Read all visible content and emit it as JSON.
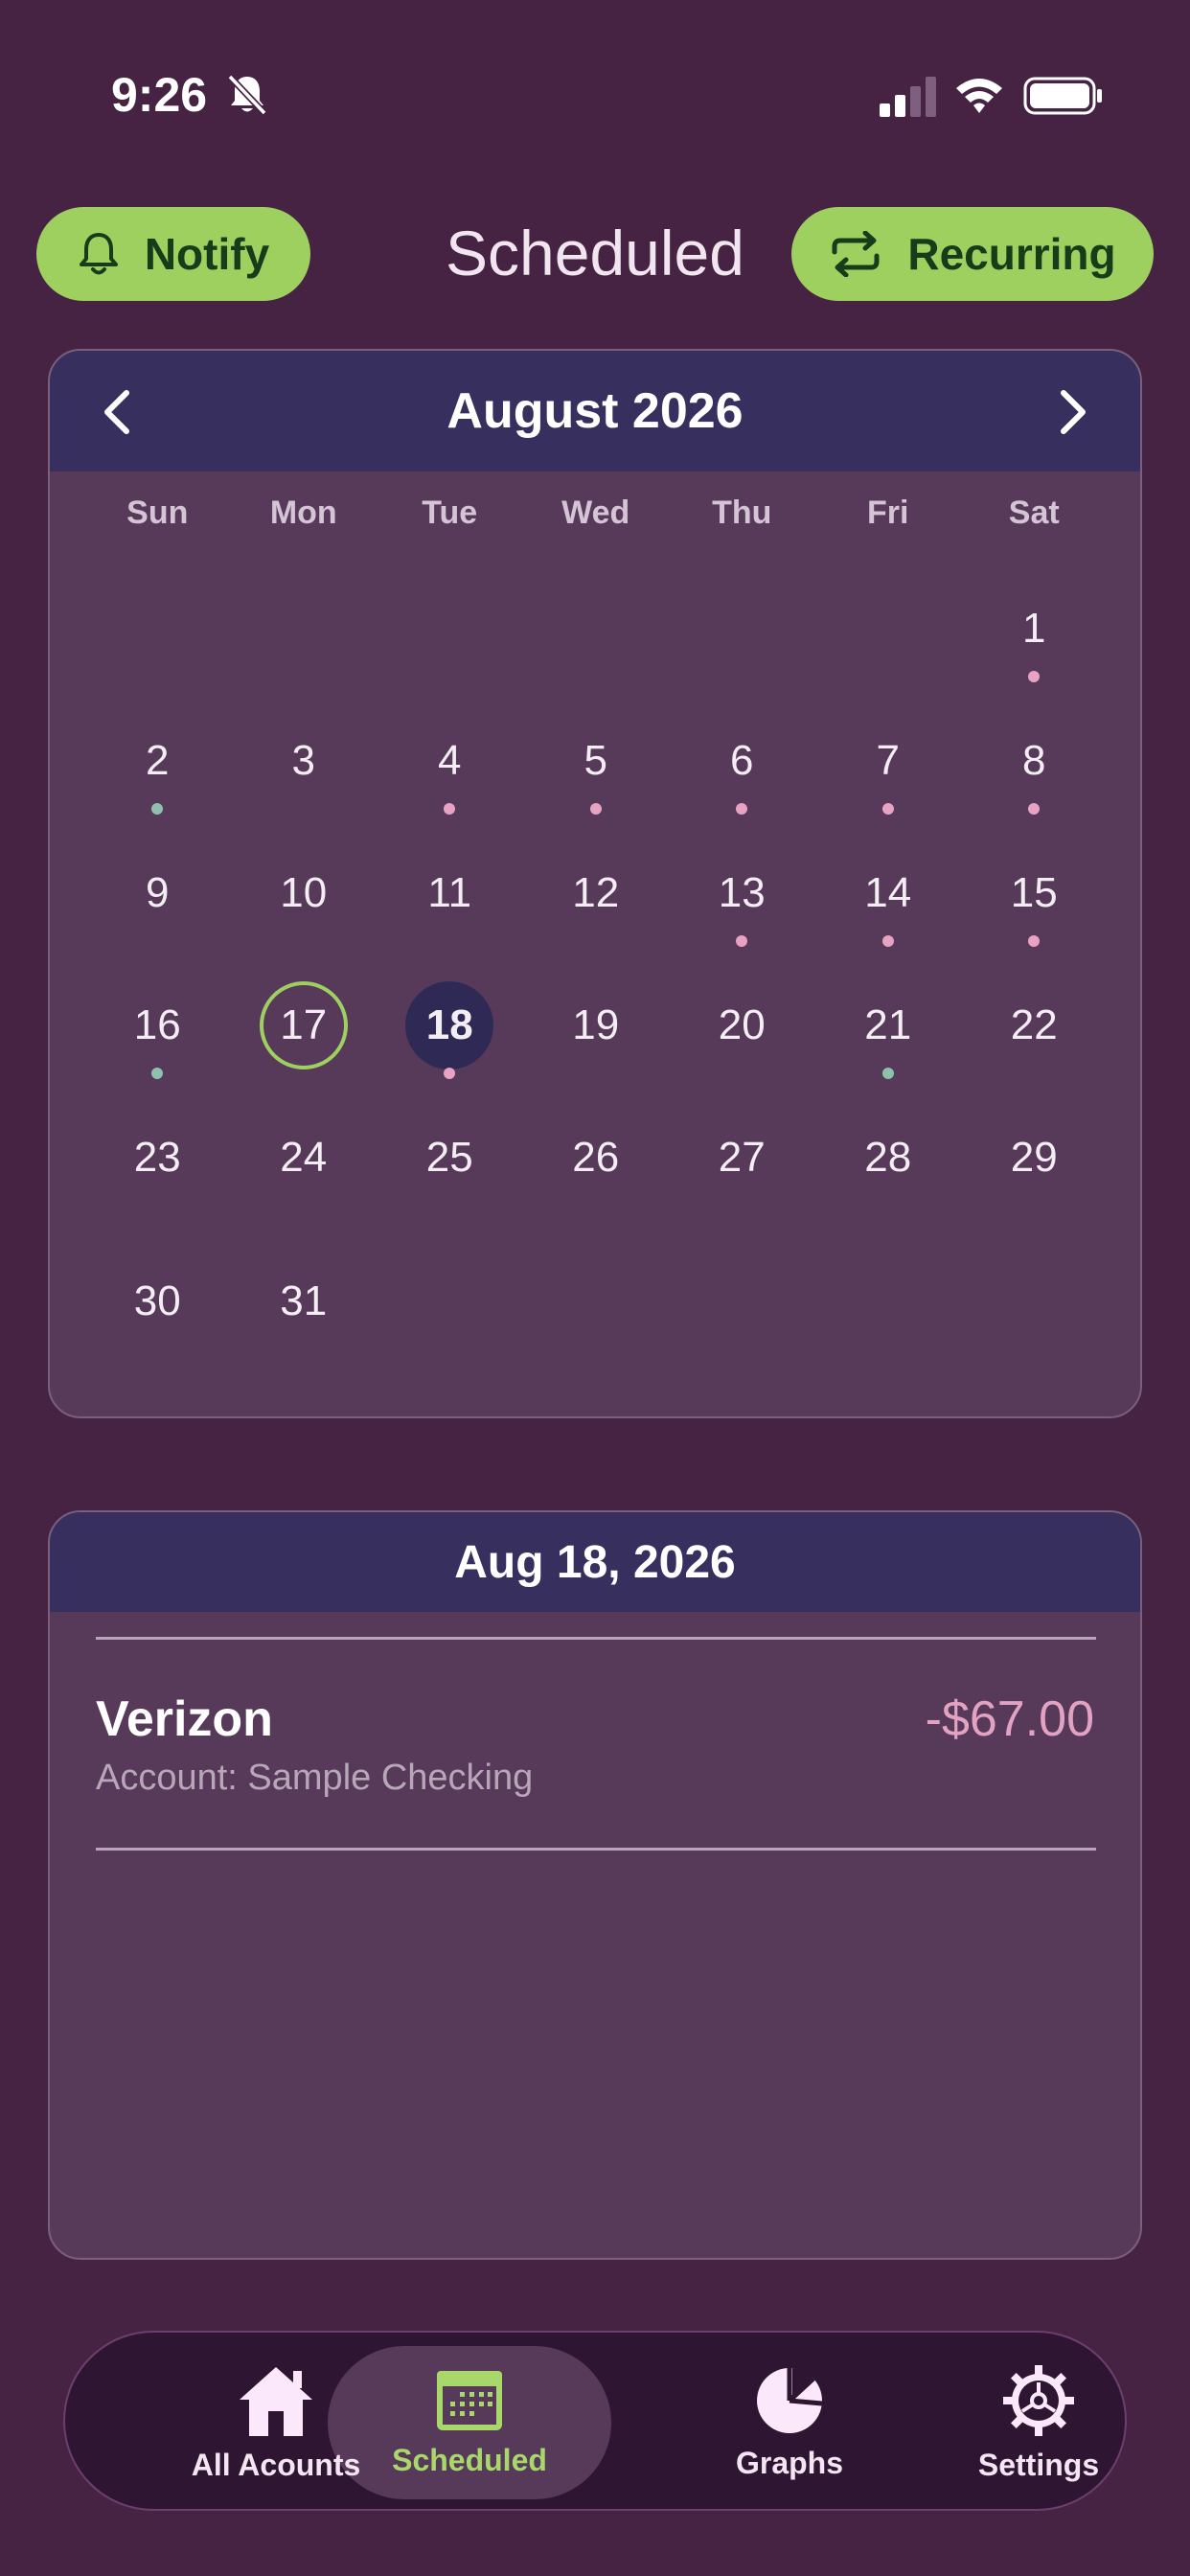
{
  "status_bar": {
    "time": "9:26"
  },
  "header": {
    "title": "Scheduled",
    "notify_label": "Notify",
    "recurring_label": "Recurring"
  },
  "calendar": {
    "month_label": "August 2026",
    "weekdays": [
      "Sun",
      "Mon",
      "Tue",
      "Wed",
      "Thu",
      "Fri",
      "Sat"
    ],
    "today": 17,
    "selected": 18,
    "weeks": [
      [
        null,
        null,
        null,
        null,
        null,
        null,
        {
          "d": 1,
          "dot": "pink"
        }
      ],
      [
        {
          "d": 2,
          "dot": "teal"
        },
        {
          "d": 3
        },
        {
          "d": 4,
          "dot": "pink"
        },
        {
          "d": 5,
          "dot": "pink"
        },
        {
          "d": 6,
          "dot": "pink"
        },
        {
          "d": 7,
          "dot": "pink"
        },
        {
          "d": 8,
          "dot": "pink"
        }
      ],
      [
        {
          "d": 9
        },
        {
          "d": 10
        },
        {
          "d": 11
        },
        {
          "d": 12
        },
        {
          "d": 13,
          "dot": "pink"
        },
        {
          "d": 14,
          "dot": "pink"
        },
        {
          "d": 15,
          "dot": "pink"
        }
      ],
      [
        {
          "d": 16,
          "dot": "teal"
        },
        {
          "d": 17
        },
        {
          "d": 18,
          "dot": "pink"
        },
        {
          "d": 19
        },
        {
          "d": 20
        },
        {
          "d": 21,
          "dot": "teal"
        },
        {
          "d": 22
        }
      ],
      [
        {
          "d": 23
        },
        {
          "d": 24
        },
        {
          "d": 25
        },
        {
          "d": 26
        },
        {
          "d": 27
        },
        {
          "d": 28
        },
        {
          "d": 29
        }
      ],
      [
        {
          "d": 30
        },
        {
          "d": 31
        },
        null,
        null,
        null,
        null,
        null
      ]
    ]
  },
  "agenda": {
    "date_label": "Aug 18, 2026",
    "transaction": {
      "name": "Verizon",
      "account": "Account: Sample Checking",
      "amount": "-$67.00"
    }
  },
  "bottom_nav": {
    "items": [
      {
        "label": "All Acounts",
        "icon": "home-icon"
      },
      {
        "label": "Scheduled",
        "icon": "calendar-icon",
        "active": true
      },
      {
        "label": "Graphs",
        "icon": "pie-chart-icon"
      },
      {
        "label": "Settings",
        "icon": "gear-icon"
      }
    ]
  },
  "colors": {
    "background": "#462243",
    "accent_green": "#9ed060",
    "card": "#573a59",
    "card_header": "#372f5d",
    "dot_pink": "#e8a2c3",
    "dot_teal": "#8ec1ad",
    "amount_pink": "#e3a2c2"
  }
}
